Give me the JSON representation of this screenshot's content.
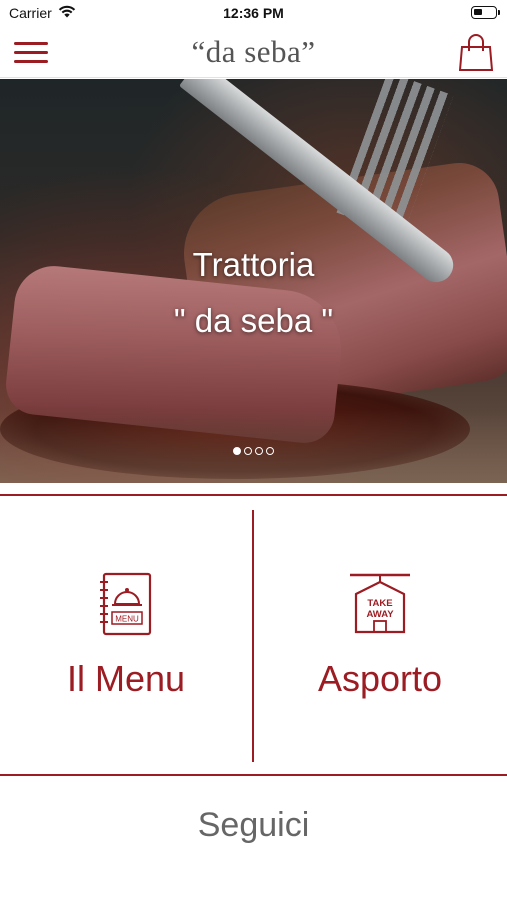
{
  "status_bar": {
    "carrier": "Carrier",
    "time": "12:36 PM",
    "battery_level": 0.4
  },
  "nav": {
    "title": "“da seba”",
    "menu_icon": "hamburger-menu-icon",
    "cart_icon": "shopping-bag-icon"
  },
  "hero": {
    "caption_line1": "Trattoria",
    "caption_line2": "\" da seba \"",
    "slides": 4,
    "active_slide": 1
  },
  "tiles": {
    "menu": {
      "label": "Il Menu",
      "icon": "menu-book-icon",
      "icon_text": "MENU"
    },
    "takeaway": {
      "label": "Asporto",
      "icon": "takeaway-sign-icon",
      "icon_text_1": "TAKE",
      "icon_text_2": "AWAY"
    }
  },
  "footer": {
    "follow_label": "Seguici"
  },
  "colors": {
    "accent": "#9b1c22",
    "muted_text": "#666666"
  }
}
